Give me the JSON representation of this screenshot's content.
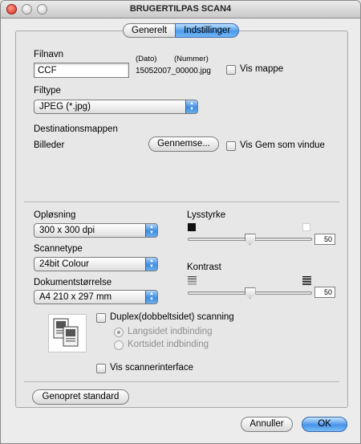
{
  "window": {
    "title": "BRUGERTILPAS SCAN4"
  },
  "tabs": [
    {
      "label": "Generelt",
      "active": false
    },
    {
      "label": "Indstillinger",
      "active": true
    }
  ],
  "file": {
    "filename_label": "Filnavn",
    "filename_value": "CCF",
    "date_label": "(Dato)",
    "number_label": "(Nummer)",
    "generated_name": "15052007_00000.jpg",
    "show_folder_label": "Vis mappe",
    "show_folder_checked": false
  },
  "filetype": {
    "label": "Filtype",
    "selected": "JPEG (*.jpg)"
  },
  "destination": {
    "label": "Destinationsmappen",
    "folder": "Billeder",
    "browse_button": "Gennemse...",
    "show_save_window_label": "Vis Gem som vindue",
    "show_save_window_checked": false
  },
  "resolution": {
    "label": "Opløsning",
    "selected": "300 x 300 dpi"
  },
  "scantype": {
    "label": "Scannetype",
    "selected": "24bit Colour"
  },
  "docsize": {
    "label": "Dokumentstørrelse",
    "selected": "A4  210 x 297 mm"
  },
  "brightness": {
    "label": "Lysstyrke",
    "value": "50",
    "level": 0.5
  },
  "contrast": {
    "label": "Kontrast",
    "value": "50",
    "level": 0.5
  },
  "duplex": {
    "label": "Duplex(dobbeltsidet) scanning",
    "checked": false,
    "long_edge_label": "Langsidet indbinding",
    "short_edge_label": "Kortsidet indbinding",
    "selected_binding": "long"
  },
  "scanner_interface": {
    "label": "Vis scannerinterface",
    "checked": false
  },
  "buttons": {
    "restore": "Genopret standard",
    "cancel": "Annuller",
    "ok": "OK"
  },
  "colors": {
    "accent": "#4c9cec",
    "panel": "#e7e7e7"
  }
}
